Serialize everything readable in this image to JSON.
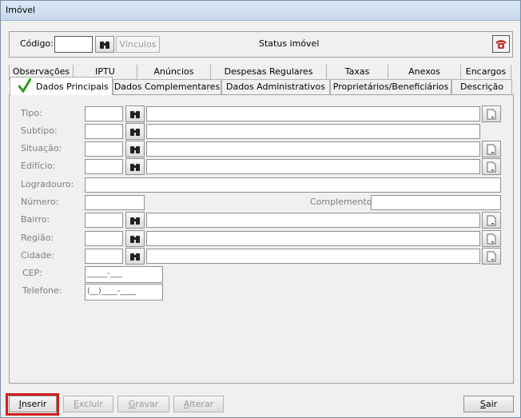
{
  "window": {
    "title": "Imóvel"
  },
  "header": {
    "codigo_label": "Código:",
    "codigo_value": "",
    "vinculos_label": "Vínculos",
    "status_label": "Status imóvel"
  },
  "tabs": {
    "row1": [
      "Observações",
      "IPTU",
      "Anúncios",
      "Despesas Regulares",
      "Taxas",
      "Anexos",
      "Encargos"
    ],
    "row2": [
      "Dados Principais",
      "Dados Complementares",
      "Dados Administrativos",
      "Proprietários/Beneficiários",
      "Descrição"
    ],
    "active": "Dados Principais"
  },
  "form": {
    "tipo": "Tipo:",
    "subtipo": "Subtipo:",
    "situacao": "Situação:",
    "edificio": "Edifício:",
    "logradouro": "Logradouro:",
    "numero": "Número:",
    "complemento": "Complemento:",
    "bairro": "Bairro:",
    "regiao": "Região:",
    "cidade": "Cidade:",
    "cep": "CEP:",
    "cep_mask": "_____-___",
    "telefone": "Telefone:",
    "telefone_mask": "(__)____-____"
  },
  "buttons": {
    "inserir": {
      "hotkey": "I",
      "rest": "nserir"
    },
    "excluir": {
      "hotkey": "E",
      "rest": "xcluir"
    },
    "gravar": {
      "hotkey": "G",
      "rest": "ravar"
    },
    "alterar": {
      "hotkey": "A",
      "rest": "lterar"
    },
    "sair": {
      "hotkey": "S",
      "rest": "air"
    }
  },
  "colors": {
    "highlight": "#d21d1d",
    "check": "#2e9a1c"
  },
  "icons": [
    "binoculars-icon",
    "document-icon",
    "phone-icon",
    "checkmark-icon"
  ]
}
